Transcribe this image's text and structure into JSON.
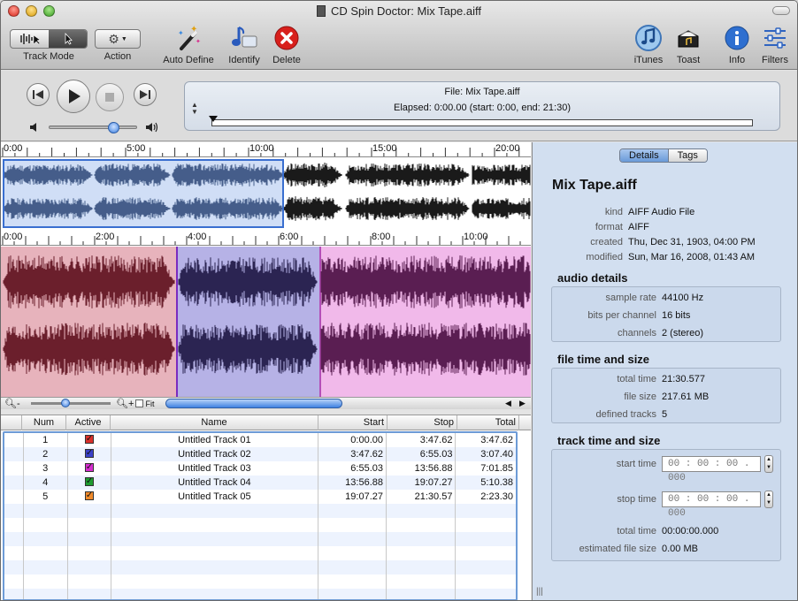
{
  "window": {
    "title": "CD Spin Doctor: Mix Tape.aiff"
  },
  "toolbar": {
    "track_mode": "Track Mode",
    "action": "Action",
    "auto_define": "Auto Define",
    "identify": "Identify",
    "delete": "Delete",
    "itunes": "iTunes",
    "toast": "Toast",
    "info": "Info",
    "filters": "Filters"
  },
  "player": {
    "file_line": "File: Mix Tape.aiff",
    "elapsed_line": "Elapsed: 0:00.00 (start: 0:00, end: 21:30)",
    "volume": 0.72,
    "progress": 0.0
  },
  "overview_ruler": [
    "0:00",
    "5:00",
    "10:00",
    "15:00",
    "20:00"
  ],
  "detail_ruler": [
    "0:00",
    "2:00",
    "4:00",
    "6:00",
    "8:00",
    "10:00"
  ],
  "zoom": {
    "fit_label": "Fit"
  },
  "table": {
    "columns": [
      "Num",
      "Active",
      "Name",
      "Start",
      "Stop",
      "Total"
    ],
    "rows": [
      {
        "num": "1",
        "color": "#d9302a",
        "name": "Untitled Track 01",
        "start": "0:00.00",
        "stop": "3:47.62",
        "total": "3:47.62"
      },
      {
        "num": "2",
        "color": "#3a40c8",
        "name": "Untitled Track 02",
        "start": "3:47.62",
        "stop": "6:55.03",
        "total": "3:07.40"
      },
      {
        "num": "3",
        "color": "#d52ccf",
        "name": "Untitled Track 03",
        "start": "6:55.03",
        "stop": "13:56.88",
        "total": "7:01.85"
      },
      {
        "num": "4",
        "color": "#1e9b2f",
        "name": "Untitled Track 04",
        "start": "13:56.88",
        "stop": "19:07.27",
        "total": "5:10.38"
      },
      {
        "num": "5",
        "color": "#f08a2a",
        "name": "Untitled Track 05",
        "start": "19:07.27",
        "stop": "21:30.57",
        "total": "2:23.30"
      }
    ]
  },
  "details": {
    "tabs": [
      "Details",
      "Tags"
    ],
    "file_name": "Mix Tape.aiff",
    "info": [
      {
        "k": "kind",
        "v": "AIFF Audio File"
      },
      {
        "k": "format",
        "v": "AIFF"
      },
      {
        "k": "created",
        "v": "Thu, Dec 31, 1903, 04:00 PM"
      },
      {
        "k": "modified",
        "v": "Sun, Mar 16, 2008, 01:43 AM"
      }
    ],
    "audio_title": "audio details",
    "audio": [
      {
        "k": "sample rate",
        "v": "44100 Hz"
      },
      {
        "k": "bits per channel",
        "v": "16 bits"
      },
      {
        "k": "channels",
        "v": "2 (stereo)"
      }
    ],
    "file_title": "file time and size",
    "file": [
      {
        "k": "total time",
        "v": "21:30.577"
      },
      {
        "k": "file size",
        "v": "217.61 MB"
      },
      {
        "k": "defined tracks",
        "v": "5"
      }
    ],
    "track_title": "track time and size",
    "start_label": "start time",
    "start_value": "00 : 00 : 00 . 000",
    "stop_label": "stop time",
    "stop_value": "00 : 00 : 00 . 000",
    "total_label": "total time",
    "total_value": "00:00:00.000",
    "est_label": "estimated file size",
    "est_value": "0.00 MB"
  }
}
